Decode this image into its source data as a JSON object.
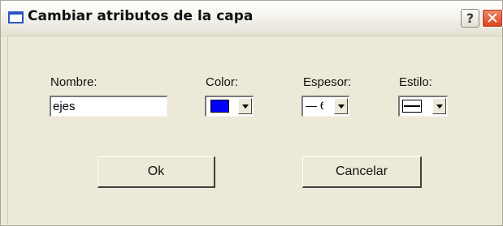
{
  "window": {
    "title": "Cambiar atributos de la capa",
    "help_label": "?",
    "close_label": "✕"
  },
  "form": {
    "nombre_label": "Nombre:",
    "nombre_value": "ejes",
    "color_label": "Color:",
    "color_value": "#0000ff",
    "espesor_label": "Espesor:",
    "espesor_value": "— 6",
    "estilo_label": "Estilo:"
  },
  "buttons": {
    "ok_label": "Ok",
    "cancel_label": "Cancelar"
  }
}
